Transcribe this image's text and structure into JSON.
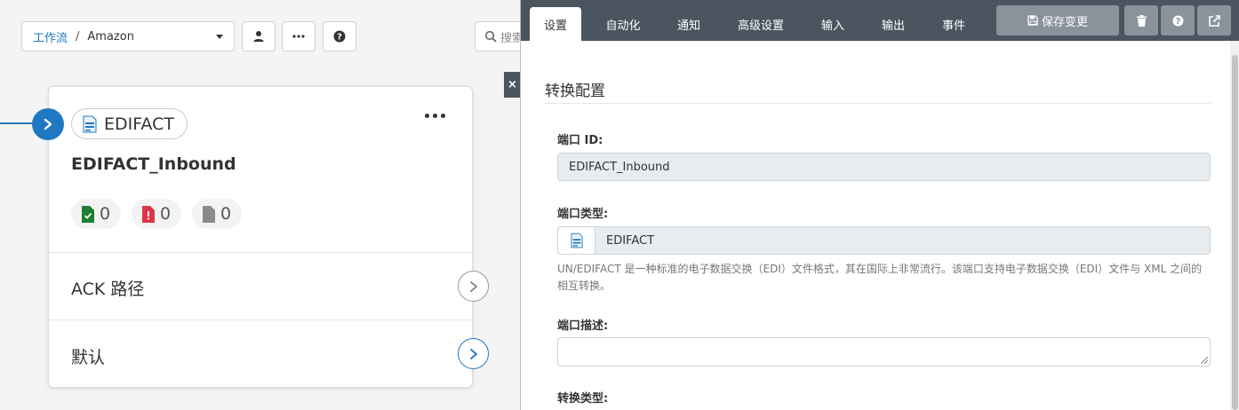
{
  "breadcrumb": {
    "link": "工作流",
    "separator": "/",
    "current": "Amazon"
  },
  "search": {
    "placeholder": "搜索"
  },
  "close_label": "×",
  "node": {
    "type_label": "EDIFACT",
    "name": "EDIFACT_Inbound",
    "stats": {
      "success": "0",
      "error": "0",
      "pending": "0"
    },
    "routes": [
      {
        "label": "ACK 路径"
      },
      {
        "label": "默认"
      }
    ]
  },
  "panel": {
    "tabs": [
      "设置",
      "自动化",
      "通知",
      "高级设置",
      "输入",
      "输出",
      "事件"
    ],
    "active_tab": "设置",
    "save_label": "保存变更",
    "section_title": "转换配置",
    "port_id": {
      "label": "端口 ID:",
      "value": "EDIFACT_Inbound"
    },
    "port_type": {
      "label": "端口类型:",
      "value": "EDIFACT",
      "help": "UN/EDIFACT 是一种标准的电子数据交换（EDI）文件格式，其在国际上非常流行。该端口支持电子数据交换（EDI）文件与 XML 之间的相互转换。"
    },
    "port_desc": {
      "label": "端口描述:",
      "value": ""
    },
    "convert_type": {
      "label": "转换类型:"
    }
  },
  "colors": {
    "accent": "#1f78c1",
    "tabbar": "#4a5560",
    "success": "#1e7e34",
    "error": "#dc3545",
    "muted": "#777777"
  }
}
